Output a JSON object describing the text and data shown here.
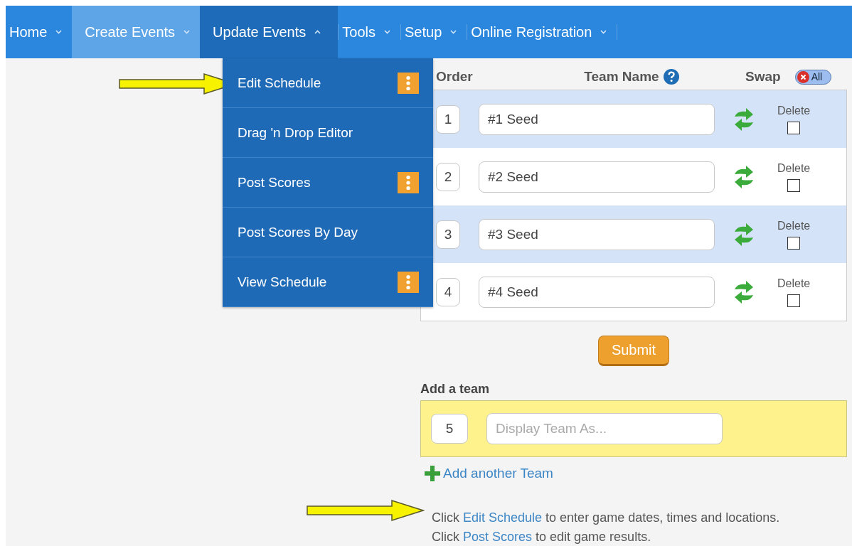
{
  "nav": [
    {
      "label": "Home",
      "highlighted": false,
      "expanded": false
    },
    {
      "label": "Create Events",
      "highlighted": true,
      "expanded": false
    },
    {
      "label": "Update Events",
      "highlighted": false,
      "expanded": true
    },
    {
      "label": "Tools",
      "highlighted": false,
      "expanded": false
    },
    {
      "label": "Setup",
      "highlighted": false,
      "expanded": false
    },
    {
      "label": "Online Registration",
      "highlighted": false,
      "expanded": false
    }
  ],
  "dropdown": [
    {
      "label": "Edit Schedule",
      "has_options": true
    },
    {
      "label": "Drag 'n Drop Editor",
      "has_options": false
    },
    {
      "label": "Post Scores",
      "has_options": true
    },
    {
      "label": "Post Scores By Day",
      "has_options": false
    },
    {
      "label": "View Schedule",
      "has_options": true
    }
  ],
  "table": {
    "columns": [
      "Order",
      "Team Name",
      "Swap"
    ],
    "all_button": "All",
    "rows": [
      {
        "order": "1",
        "name": "#1 Seed",
        "delete_label": "Delete",
        "delete": false
      },
      {
        "order": "2",
        "name": "#2 Seed",
        "delete_label": "Delete",
        "delete": false
      },
      {
        "order": "3",
        "name": "#3 Seed",
        "delete_label": "Delete",
        "delete": false
      },
      {
        "order": "4",
        "name": "#4 Seed",
        "delete_label": "Delete",
        "delete": false
      }
    ]
  },
  "submit": "Submit",
  "add_team": {
    "title": "Add a team",
    "order": "5",
    "placeholder": "Display Team As...",
    "add_link": "Add another Team"
  },
  "help": [
    {
      "before": "Click ",
      "link": "Edit Schedule",
      "after": " to enter game dates, times and locations."
    },
    {
      "before": "Click ",
      "link": "Post Scores",
      "after": " to edit game results."
    }
  ]
}
